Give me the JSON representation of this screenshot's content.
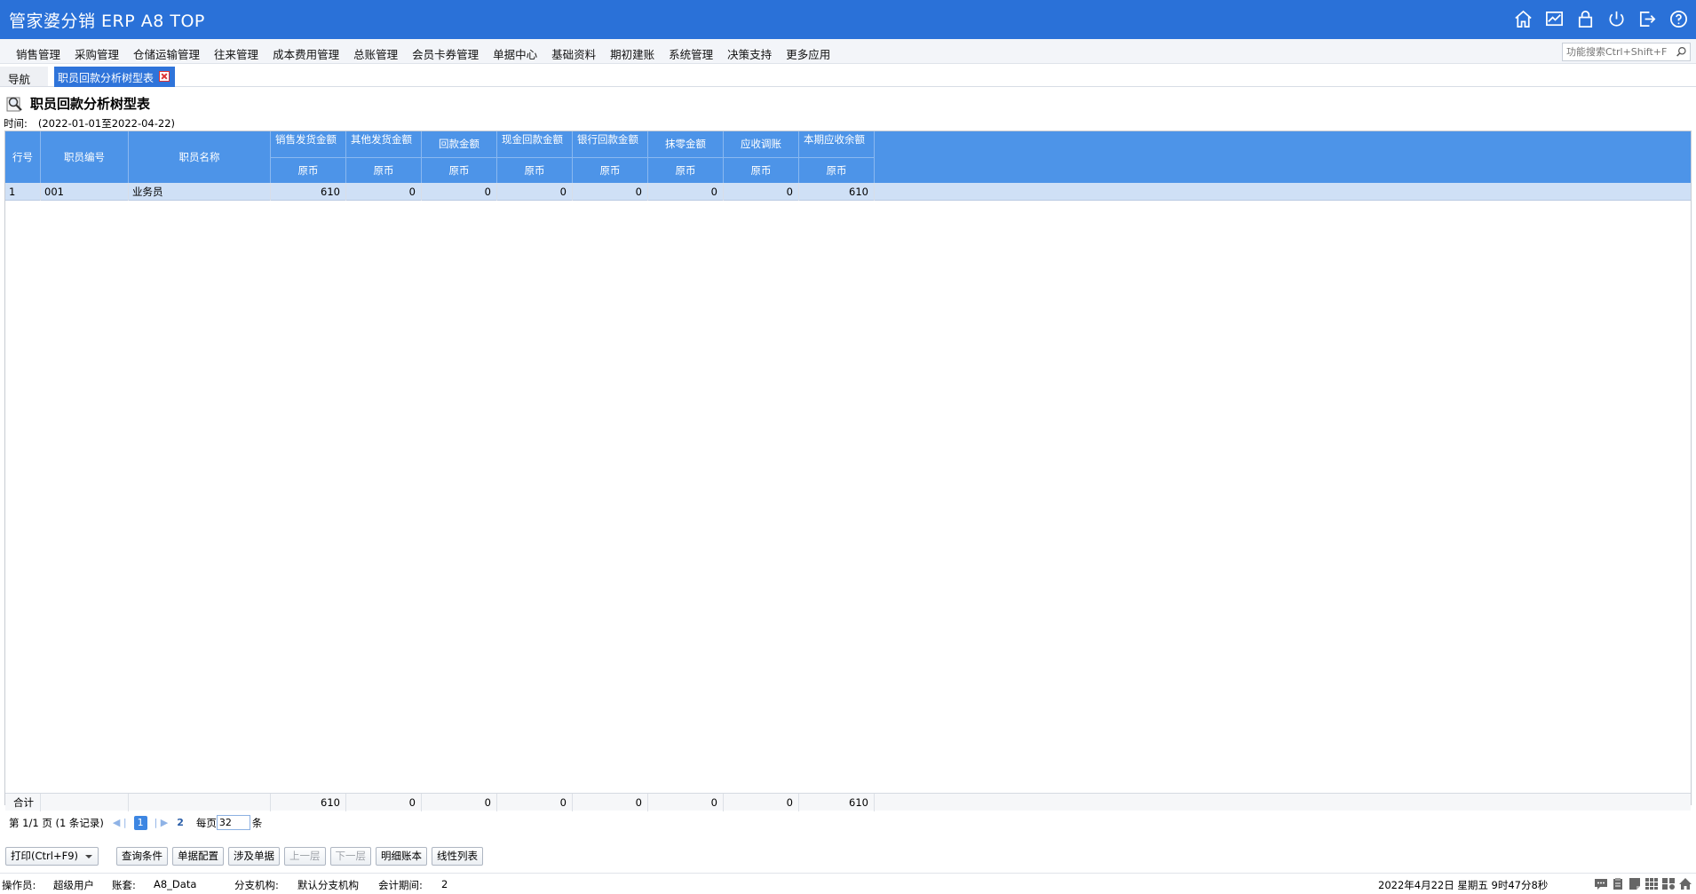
{
  "app": {
    "title": "管家婆分销 ERP A8 TOP",
    "icons": [
      "home-icon",
      "chart-icon",
      "lock-icon",
      "power-icon",
      "logout-icon",
      "help-icon"
    ]
  },
  "menu": {
    "items": [
      "销售管理",
      "采购管理",
      "仓储运输管理",
      "往来管理",
      "成本费用管理",
      "总账管理",
      "会员卡券管理",
      "单据中心",
      "基础资料",
      "期初建账",
      "系统管理",
      "决策支持",
      "更多应用"
    ],
    "search_placeholder": "功能搜索Ctrl+Shift+F"
  },
  "tabs": {
    "nav_label": "导航",
    "active_label": "职员回款分析树型表"
  },
  "report": {
    "title": "职员回款分析树型表",
    "time_label": "时间:",
    "time_value": "(2022-01-01至2022-04-22)"
  },
  "grid": {
    "headers": {
      "rownum": "行号",
      "code": "职员编号",
      "name": "职员名称",
      "sales": "销售发货金额",
      "other": "其他发货金额",
      "refund": "回款金额",
      "cash": "现金回款金额",
      "bank": "银行回款金额",
      "wipe": "抹零金额",
      "adjust": "应收调账",
      "balance": "本期应收余额",
      "sub": "原币"
    },
    "rows": [
      {
        "rownum": "1",
        "code": "001",
        "name": "业务员",
        "sales": "610",
        "other": "0",
        "refund": "0",
        "cash": "0",
        "bank": "0",
        "wipe": "0",
        "adjust": "0",
        "balance": "610"
      }
    ],
    "total": {
      "label": "合计",
      "sales": "610",
      "other": "0",
      "refund": "0",
      "cash": "0",
      "bank": "0",
      "wipe": "0",
      "adjust": "0",
      "balance": "610"
    }
  },
  "pager": {
    "info": "第  1/1 页  (1 条记录)",
    "current_page": "1",
    "page_two": "2",
    "per_page_label": "每页",
    "per_page_value": "32",
    "unit": "条"
  },
  "toolbar": {
    "print": "打印(Ctrl+F9)",
    "query": "查询条件",
    "config": "单据配置",
    "related": "涉及单据",
    "up": "上一层",
    "down": "下一层",
    "detail": "明细账本",
    "linear": "线性列表"
  },
  "status": {
    "operator_label": "操作员:",
    "operator": "超级用户",
    "account_label": "账套:",
    "account": "A8_Data",
    "branch_label": "分支机构:",
    "branch": "默认分支机构",
    "period_label": "会计期间:",
    "period": "2",
    "datetime": "2022年4月22日  星期五  9时47分8秒"
  }
}
